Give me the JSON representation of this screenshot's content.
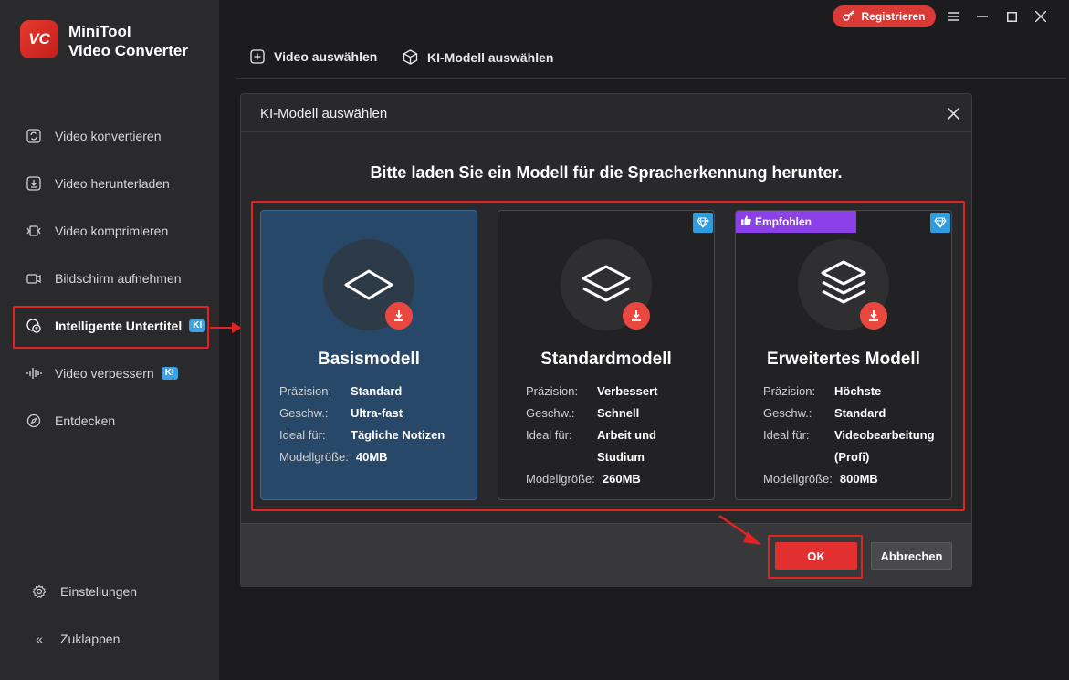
{
  "app": {
    "logo_text": "VC",
    "title_line1": "MiniTool",
    "title_line2": "Video Converter"
  },
  "titlebar": {
    "register_label": "Registrieren"
  },
  "sidebar": {
    "items": [
      {
        "label": "Video konvertieren",
        "icon": "convert-icon"
      },
      {
        "label": "Video herunterladen",
        "icon": "download-icon"
      },
      {
        "label": "Video komprimieren",
        "icon": "compress-icon"
      },
      {
        "label": "Bildschirm aufnehmen",
        "icon": "camera-icon"
      },
      {
        "label": "Intelligente Untertitel",
        "icon": "subtitle-icon",
        "badge": "KI",
        "active": true
      },
      {
        "label": "Video verbessern",
        "icon": "waveform-icon",
        "badge": "KI"
      },
      {
        "label": "Entdecken",
        "icon": "compass-icon"
      }
    ],
    "settings_label": "Einstellungen",
    "collapse_label": "Zuklappen"
  },
  "tabs": {
    "select_video": "Video auswählen",
    "select_model": "KI-Modell auswählen"
  },
  "modal": {
    "title": "KI-Modell auswählen",
    "heading": "Bitte laden Sie ein Modell für die Spracherkennung herunter.",
    "cards": [
      {
        "name": "Basismodell",
        "selected": true,
        "specs": [
          {
            "key": "Präzision:",
            "val": "Standard"
          },
          {
            "key": "Geschw.:",
            "val": "Ultra-fast"
          },
          {
            "key": "Ideal für:",
            "val": "Tägliche Notizen"
          },
          {
            "key": "Modellgröße:",
            "val": "40MB"
          }
        ]
      },
      {
        "name": "Standardmodell",
        "premium": true,
        "specs": [
          {
            "key": "Präzision:",
            "val": "Verbessert"
          },
          {
            "key": "Geschw.:",
            "val": "Schnell"
          },
          {
            "key": "Ideal für:",
            "val": "Arbeit und Studium"
          },
          {
            "key": "Modellgröße:",
            "val": "260MB"
          }
        ]
      },
      {
        "name": "Erweitertes Modell",
        "premium": true,
        "recommended": "Empfohlen",
        "specs": [
          {
            "key": "Präzision:",
            "val": "Höchste"
          },
          {
            "key": "Geschw.:",
            "val": "Standard"
          },
          {
            "key": "Ideal für:",
            "val": "Videobearbeitung (Profi)"
          },
          {
            "key": "Modellgröße:",
            "val": "800MB"
          }
        ]
      }
    ],
    "ok_label": "OK",
    "cancel_label": "Abbrechen"
  },
  "colors": {
    "accent_red": "#e22f2f",
    "selected_card": "#274868",
    "ki_badge": "#3aa3e3",
    "recommended_badge": "#8b40e8"
  }
}
